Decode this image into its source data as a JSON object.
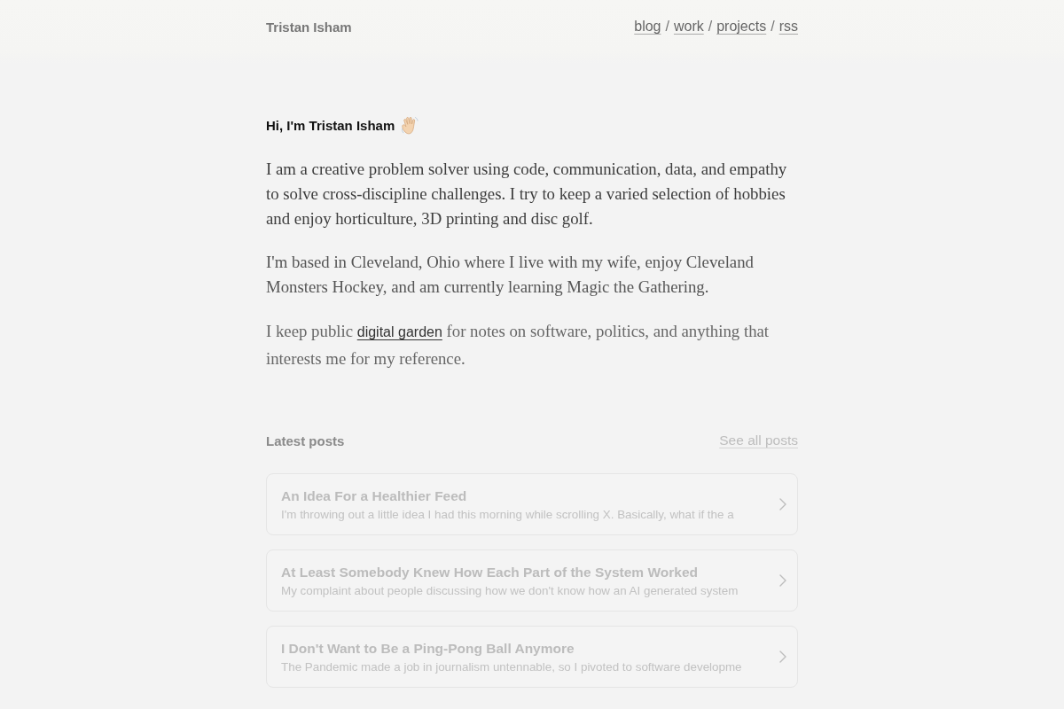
{
  "header": {
    "site_title": "Tristan Isham",
    "nav": [
      {
        "kind": "link",
        "text": "blog"
      },
      {
        "kind": "separator",
        "text": "/"
      },
      {
        "kind": "link",
        "text": "work"
      },
      {
        "kind": "separator",
        "text": "/"
      },
      {
        "kind": "link",
        "text": "projects"
      },
      {
        "kind": "separator",
        "text": "/"
      },
      {
        "kind": "link",
        "text": "rss"
      }
    ]
  },
  "intro": {
    "heading": "Hi, I'm Tristan Isham",
    "paragraphs": [
      [
        {
          "kind": "text",
          "text": "I am a creative problem solver using code, communication, data, and empathy to solve cross-discipline challenges. I try to keep a varied selection of hobbies and enjoy horticulture, 3D printing and disc golf."
        }
      ],
      [
        {
          "kind": "text",
          "text": "I'm based in Cleveland, Ohio where I live with my wife, enjoy Cleveland Monsters Hockey, and am currently learning Magic the Gathering."
        }
      ],
      [
        {
          "kind": "text",
          "text": "I keep public"
        },
        {
          "kind": "link",
          "text": "digital garden"
        },
        {
          "kind": "text",
          "text": "for notes on software, politics, and anything that interests me for my reference."
        }
      ]
    ]
  },
  "latest_posts": {
    "title": "Latest posts",
    "see_all": "See all posts",
    "posts": [
      {
        "title": "An Idea For a Healthier Feed",
        "summary": "I'm throwing out a little idea I had this morning while scrolling X. Basically, what if the a"
      },
      {
        "title": "At Least Somebody Knew How Each Part of the System Worked",
        "summary": "My complaint about people discussing how we don't know how an AI generated system"
      },
      {
        "title": "I Don't Want to Be a Ping-Pong Ball Anymore",
        "summary": "The Pandemic made a job in journalism untennable, so I pivoted to software developme"
      }
    ]
  }
}
